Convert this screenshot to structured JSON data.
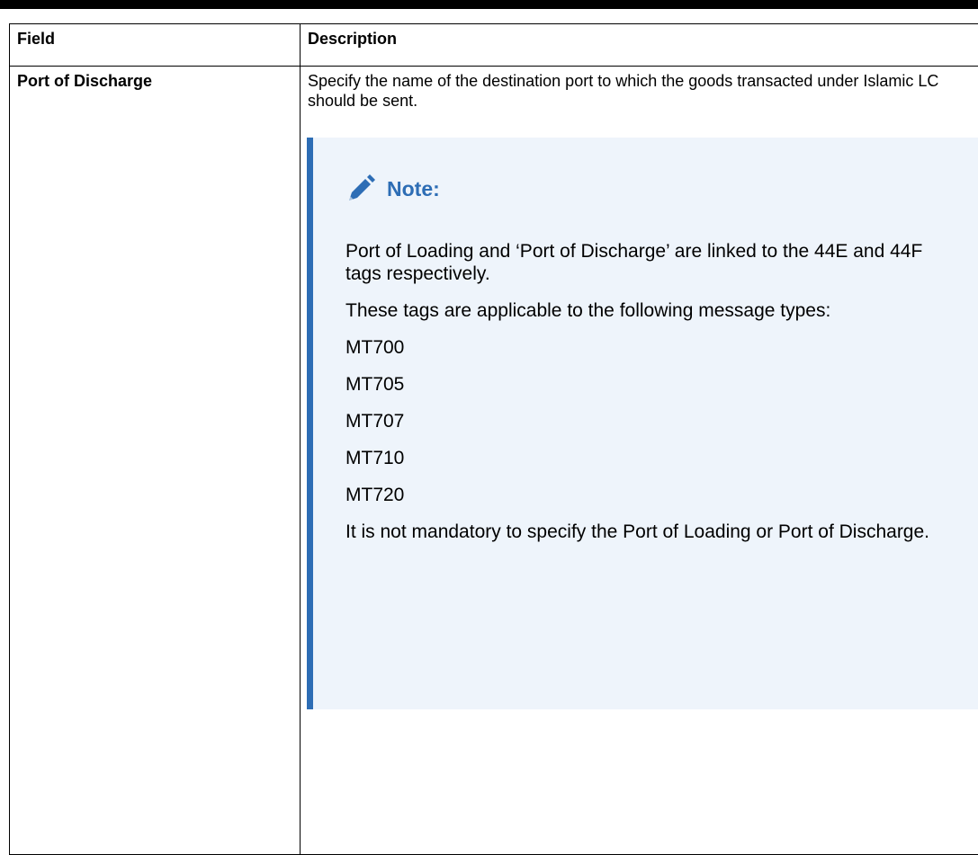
{
  "table": {
    "headers": [
      "Field",
      "Description"
    ],
    "rows": [
      {
        "field": "Port of Discharge",
        "description": "Specify the name of the destination port to which the goods transacted under Islamic LC should be sent.",
        "note": {
          "title": "Note:",
          "icon": "pencil-icon",
          "paragraphs": [
            "Port of Loading and ‘Port of Discharge’ are linked to the 44E and 44F tags respectively.",
            "These tags are applicable to the following message types:",
            "MT700",
            "MT705",
            "MT707",
            "MT710",
            "MT720",
            "It is not mandatory to specify the Port of Loading or Port of Discharge."
          ]
        }
      }
    ]
  },
  "colors": {
    "note_accent": "#2d6db5",
    "note_background": "#eef4fb"
  }
}
